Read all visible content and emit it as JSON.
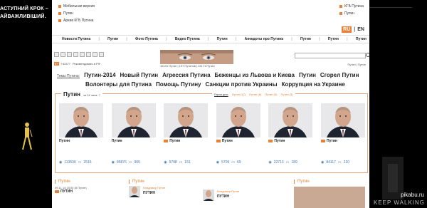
{
  "left_ad": {
    "line1": "АСТУПНИЙ КРОК –",
    "line2": "АЙВАЖЛИВІШИЙ."
  },
  "right_ad": {
    "bottom_text": "KEEP WALKING",
    "watermark": "pikabu.ru"
  },
  "top_links": {
    "left": [
      "Мобильная версия",
      "Путин",
      "Архив КГБ Путина"
    ],
    "right": [
      "КГБ Путина",
      "Путин"
    ]
  },
  "lang": {
    "active": "RU",
    "other": "EN"
  },
  "nav": [
    "Новости Путина",
    "Путин",
    "Фото Путина",
    "Видео Путина",
    "Путин",
    "Анекдоты про Путина",
    "Путин",
    "Путин",
    "Путин"
  ],
  "social": {
    "count": "+42477",
    "recommend": "Рекомендовать в РФ",
    "gplus": "8+"
  },
  "banner": {
    "caption": "15101 Путин | 197 Путинов | 24171 Путин"
  },
  "search": {
    "sub": "Путин | Путин"
  },
  "tags": {
    "label": "Темы Путина:",
    "row1": [
      "Путин-2014",
      "Новый Путин",
      "Агрессия Путина",
      "Беженцы из Львова и Киева",
      "Путин",
      "Сгорел Путин"
    ],
    "row2": [
      "Волонтеры для Путина",
      "Помощь Путину",
      "Санкции против Украины",
      "Коррупция на Украине"
    ]
  },
  "putin_box": {
    "title": "Путин",
    "subtitle": "за 24 часа: 7",
    "filters": [
      "Герои дня:",
      "Путин (12)",
      "Путин (6)",
      "Путин (5)",
      "Путин (3)"
    ],
    "cards": [
      {
        "name": "Путин",
        "views": "113530",
        "comments": "2516",
        "icon": false
      },
      {
        "name": "Путин",
        "views": "85876",
        "comments": "905",
        "icon": false
      },
      {
        "name": "Путин",
        "views": "5798",
        "comments": "151",
        "icon": true
      },
      {
        "name": "Путин",
        "views": "5709",
        "comments": "69",
        "icon": true
      },
      {
        "name": "Путин",
        "views": "22713",
        "comments": "189",
        "icon": true
      },
      {
        "name": "Путин",
        "views": "84117",
        "comments": "210",
        "icon": true
      }
    ]
  },
  "bottom": {
    "col1_title": "Путин",
    "col1_meta": "09.11 14:15:00 (8 Путин)",
    "col1_name": "ПУТИН",
    "col2_title": "Путин",
    "col2_author": "Владимир Путин",
    "col2_name": "ПУТИН",
    "col3_author": "Владимир Путин",
    "col3_name": "ПУТИН",
    "col4_title": "Путин"
  },
  "colors": {
    "accent": "#e98036",
    "link": "#3c76b8"
  }
}
